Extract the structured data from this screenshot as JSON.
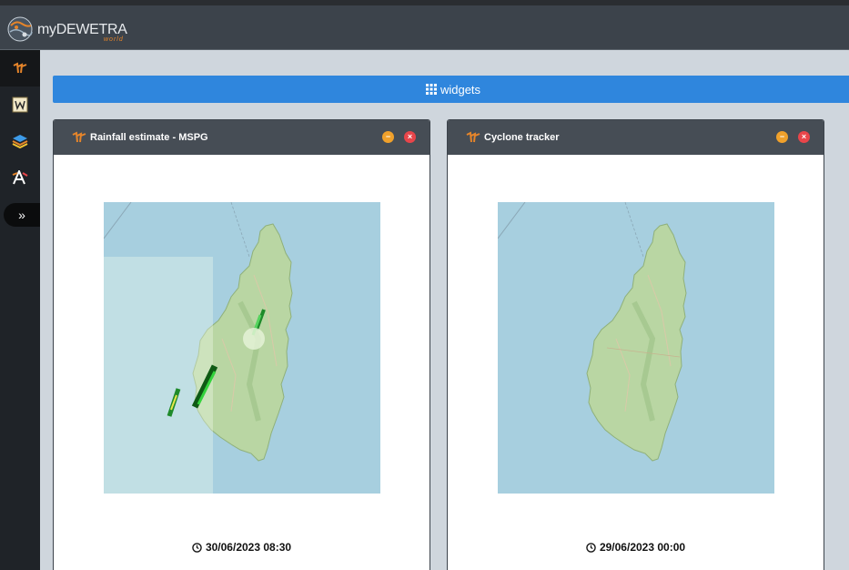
{
  "app": {
    "brand_prefix": "my",
    "brand_name": "DEWETRA",
    "brand_sub": "world"
  },
  "sidebar": {
    "items": [
      {
        "icon": "mydewetra-icon",
        "active": true
      },
      {
        "icon": "widget-w-icon",
        "active": false
      },
      {
        "icon": "layers-icon",
        "active": false
      },
      {
        "icon": "font-a-icon",
        "active": false
      }
    ],
    "expand_label": "»"
  },
  "widgets_bar": {
    "label": "widgets",
    "icon": "grid-icon"
  },
  "panels": [
    {
      "title": "Rainfall estimate - MSPG",
      "timestamp": "30/06/2023 08:30",
      "minimize_label": "−",
      "close_label": "×"
    },
    {
      "title": "Cyclone tracker",
      "timestamp": "29/06/2023 00:00",
      "minimize_label": "−",
      "close_label": "×"
    }
  ],
  "colors": {
    "header": "#3c434b",
    "sidebar": "#1f2328",
    "accent_blue": "#2f86dd",
    "brand_orange": "#e6852a",
    "minimize": "#f0a12b",
    "close": "#e8454a",
    "sea": "#a7cfdf",
    "land": "#b9d6a3"
  }
}
